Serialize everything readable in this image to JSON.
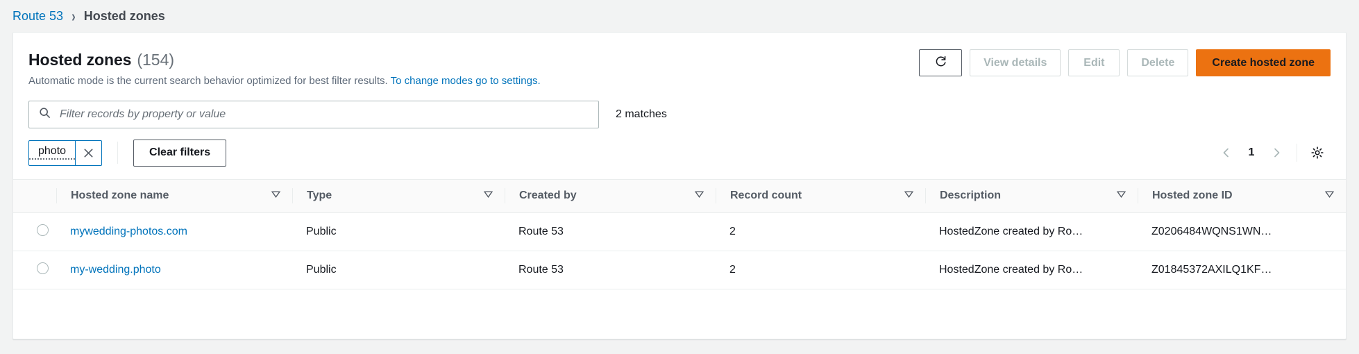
{
  "breadcrumb": {
    "root": "Route 53",
    "separator": "›",
    "current": "Hosted zones"
  },
  "header": {
    "title": "Hosted zones",
    "count": "(154)",
    "subtitle": "Automatic mode is the current search behavior optimized for best filter results.",
    "subtitle_link": "To change modes go to settings."
  },
  "actions": {
    "refresh_icon": "refresh-icon",
    "view_details": "View details",
    "edit": "Edit",
    "delete": "Delete",
    "create": "Create hosted zone"
  },
  "search": {
    "placeholder": "Filter records by property or value",
    "value": "",
    "matches": "2 matches",
    "icon": "search-icon"
  },
  "filters": {
    "token": "photo",
    "dismiss_icon": "close-icon",
    "clear": "Clear filters"
  },
  "pagination": {
    "prev_icon": "chevron-left-icon",
    "page": "1",
    "next_icon": "chevron-right-icon",
    "settings_icon": "gear-icon"
  },
  "table": {
    "columns": [
      "Hosted zone name",
      "Type",
      "Created by",
      "Record count",
      "Description",
      "Hosted zone ID"
    ],
    "sort_icon": "triangle-down-icon",
    "rows": [
      {
        "name": "mywedding-photos.com",
        "type": "Public",
        "created_by": "Route 53",
        "record_count": "2",
        "description": "HostedZone created by Ro…",
        "zone_id": "Z0206484WQNS1WN…"
      },
      {
        "name": "my-wedding.photo",
        "type": "Public",
        "created_by": "Route 53",
        "record_count": "2",
        "description": "HostedZone created by Ro…",
        "zone_id": "Z01845372AXILQ1KF…"
      }
    ]
  },
  "colors": {
    "link": "#0073bb",
    "primary": "#ec7211",
    "text": "#16191f",
    "muted": "#687078",
    "border": "#eaeded"
  }
}
